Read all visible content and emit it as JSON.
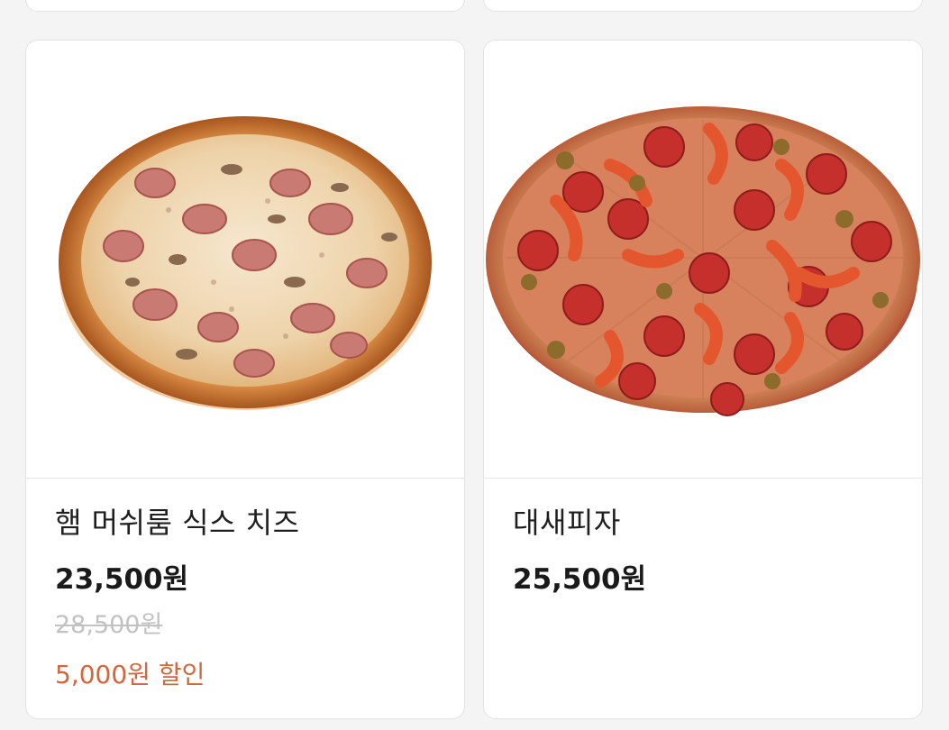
{
  "products": [
    {
      "name": "햄 머쉬룸 식스 치즈",
      "price": "23,500원",
      "original_price": "28,500원",
      "discount": "5,000원 할인",
      "image_icon": "ham-mushroom-pizza-image"
    },
    {
      "name": "대새피자",
      "price": "25,500원",
      "image_icon": "shrimp-pepperoni-pizza-image"
    }
  ],
  "colors": {
    "discount": "#d4663d",
    "original_price": "#c2c2c2",
    "card_border": "#e3e3e3"
  }
}
